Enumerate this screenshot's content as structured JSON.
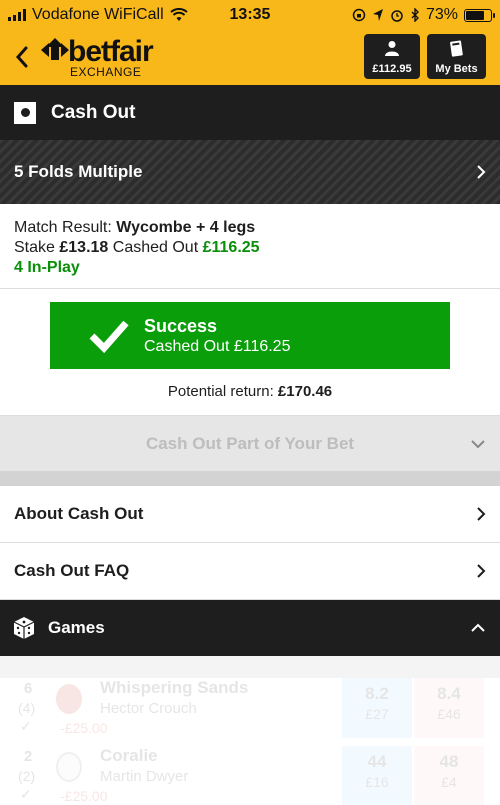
{
  "status_bar": {
    "carrier": "Vodafone WiFiCall",
    "time": "13:35",
    "battery": "73%",
    "battery_level": 0.73
  },
  "header": {
    "logo_word": "betfair",
    "logo_sub": "EXCHANGE",
    "balance": "£112.95",
    "my_bets_label": "My Bets"
  },
  "cashout_bar": {
    "title": "Cash Out"
  },
  "folds": {
    "title": "5 Folds Multiple"
  },
  "bet": {
    "match_label": "Match Result:",
    "match_value": "Wycombe + 4 legs",
    "stake_label": "Stake",
    "stake_value": "£13.18",
    "cashed_label": "Cashed Out",
    "cashed_value": "£116.25",
    "inplay": "4 In-Play"
  },
  "success": {
    "title": "Success",
    "subtitle": "Cashed Out £116.25",
    "potential_label": "Potential return:",
    "potential_value": "£170.46"
  },
  "partial": {
    "label": "Cash Out Part of Your Bet"
  },
  "links": [
    {
      "label": "About Cash Out"
    },
    {
      "label": "Cash Out FAQ"
    }
  ],
  "games": {
    "title": "Games"
  },
  "runners": [
    {
      "number": "6",
      "draw": "(4)",
      "name": "Whispering Sands",
      "jockey": "Hector Crouch",
      "stake": "-£25.00",
      "back_price": "8.2",
      "back_size": "£27",
      "lay_price": "8.4",
      "lay_size": "£46"
    },
    {
      "number": "2",
      "draw": "(2)",
      "name": "Coralie",
      "jockey": "Martin Dwyer",
      "stake": "-£25.00",
      "back_price": "44",
      "back_size": "£16",
      "lay_price": "48",
      "lay_size": "£4"
    }
  ],
  "colors": {
    "brand_yellow": "#f9b81a",
    "dark": "#1e1e1e",
    "success_green": "#0a9e0a",
    "text_green": "#0a8f0a"
  }
}
